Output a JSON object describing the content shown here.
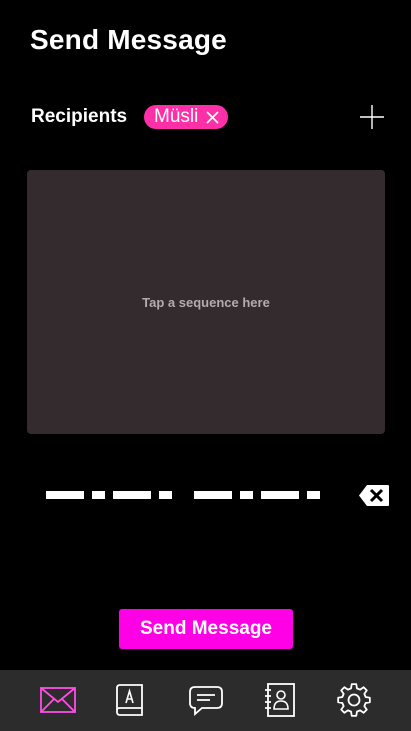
{
  "header": {
    "title": "Send Message"
  },
  "recipients": {
    "label": "Recipients",
    "chips": [
      {
        "name": "Müsli",
        "remove_icon": "close-icon"
      }
    ],
    "add_icon": "plus-icon"
  },
  "tap_area": {
    "hint": "Tap a sequence here"
  },
  "sequence": {
    "symbols": [
      "dash",
      "dot",
      "dash",
      "dot",
      "gap",
      "dash",
      "dot",
      "dash",
      "dot"
    ],
    "backspace_icon": "backspace-icon"
  },
  "actions": {
    "send_label": "Send Message"
  },
  "nav": {
    "items": [
      {
        "icon": "envelope-icon",
        "active": true
      },
      {
        "icon": "alphabet-book-icon",
        "active": false
      },
      {
        "icon": "chat-bubble-icon",
        "active": false
      },
      {
        "icon": "contacts-book-icon",
        "active": false
      },
      {
        "icon": "gear-icon",
        "active": false
      }
    ]
  },
  "colors": {
    "accent": "#ff00e6",
    "chip": "#ff2fa8",
    "tap_area_bg": "#332b2d",
    "nav_bg": "#2c2c2c",
    "nav_active": "#ff4de6",
    "nav_icon": "#ffffff"
  }
}
